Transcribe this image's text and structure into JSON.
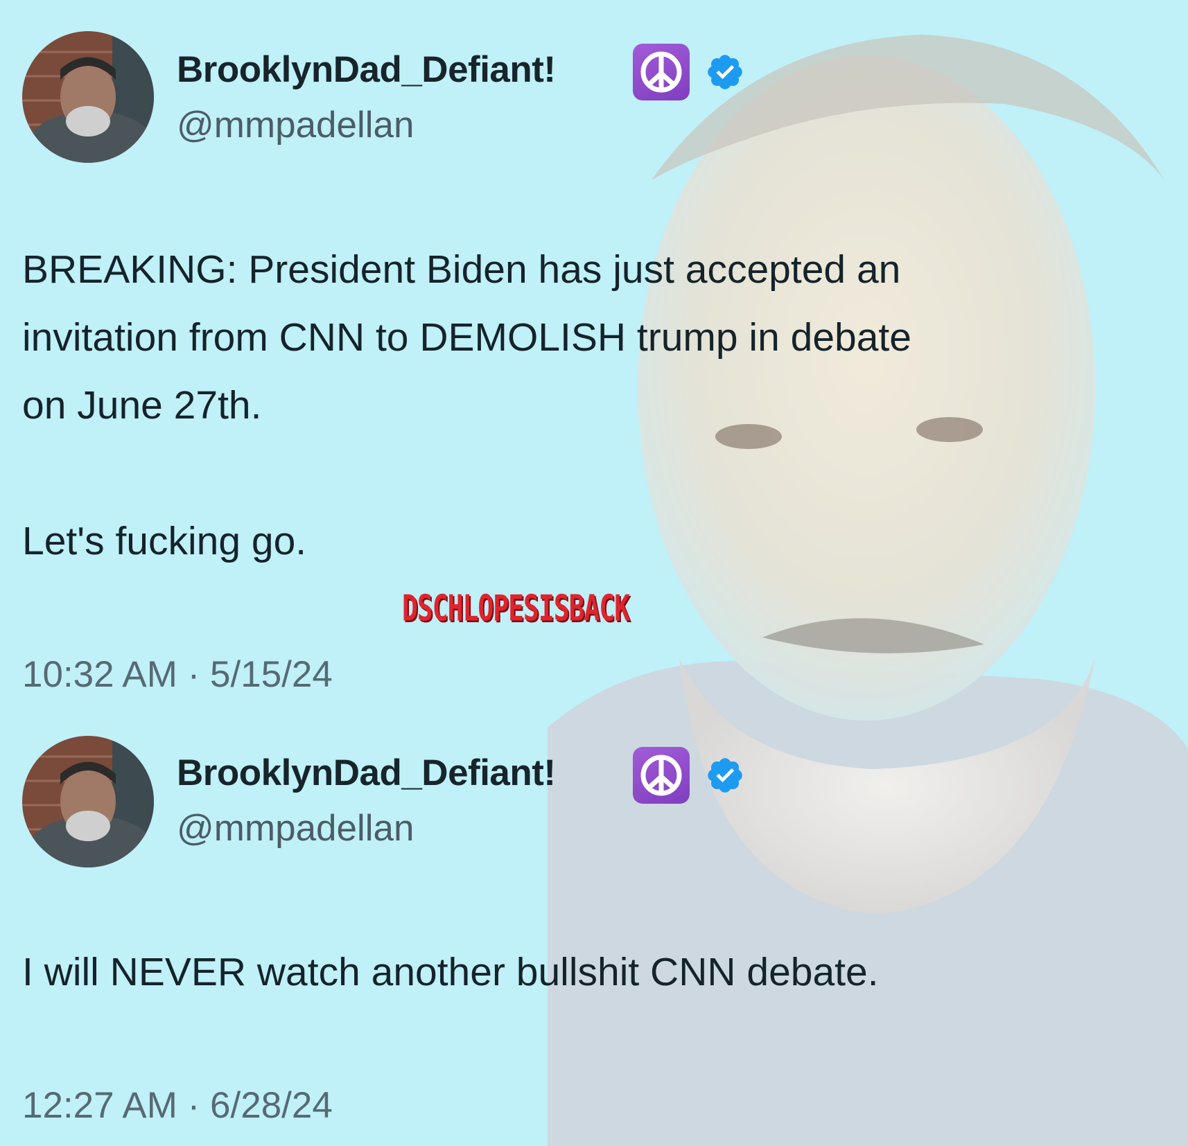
{
  "tweets": [
    {
      "display_name": "BrooklynDad_Defiant!",
      "handle": "@mmpadellan",
      "text": "BREAKING: President Biden has just accepted an\ninvitation from CNN to DEMOLISH trump in debate\non June 27th.\n\nLet's fucking go.",
      "timestamp": "10:32 AM · 5/15/24"
    },
    {
      "display_name": "BrooklynDad_Defiant!",
      "handle": "@mmpadellan",
      "text": "I will NEVER watch another bullshit CNN debate.",
      "timestamp": "12:27 AM · 6/28/24"
    }
  ],
  "watermark": "DSCHLOPESISBACK",
  "colors": {
    "background": "#c0f0f8",
    "verified_badge": "#1d9bf0",
    "peace_emoji": "#8e4cc8",
    "watermark": "#e0242d"
  }
}
